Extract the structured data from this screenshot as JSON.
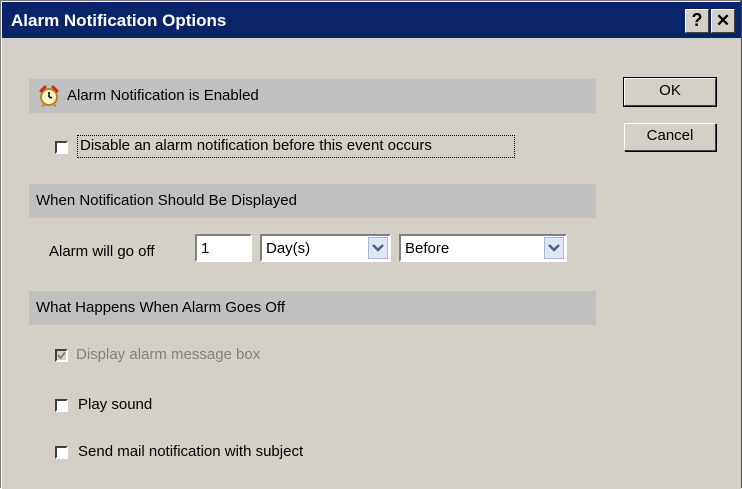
{
  "window": {
    "title": "Alarm Notification Options",
    "help_glyph": "?",
    "close_glyph": "✕"
  },
  "section_enabled": {
    "label": "Alarm Notification is Enabled",
    "icon": "alarm-clock-icon",
    "disable_checkbox": {
      "label": "Disable an alarm notification before this event occurs",
      "checked": false
    }
  },
  "section_when": {
    "label": "When Notification Should Be Displayed",
    "alarm_label": "Alarm will go off",
    "amount_value": "1",
    "unit_value": "Day(s)",
    "relation_value": "Before"
  },
  "section_what": {
    "label": "What Happens When Alarm Goes Off",
    "display_message": {
      "label": "Display alarm message box",
      "checked": true,
      "disabled": true
    },
    "play_sound": {
      "label": "Play sound",
      "checked": false
    },
    "send_mail": {
      "label": "Send mail notification with subject",
      "checked": false
    }
  },
  "buttons": {
    "ok_label": "OK",
    "cancel_label": "Cancel"
  },
  "colors": {
    "title_bar": "#0a246a",
    "dialog_bg": "#d4d0c8",
    "section_bg": "#c0c0c0",
    "disabled_text": "#808080"
  }
}
